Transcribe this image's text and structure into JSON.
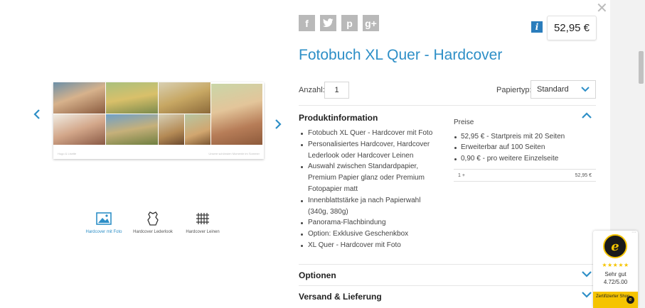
{
  "social": {
    "facebook": "f",
    "twitter": "t",
    "pinterest": "p",
    "googleplus": "g+"
  },
  "price": {
    "info_icon": "i",
    "value": "52,95 €"
  },
  "product": {
    "title": "Fotobuch XL Quer - Hardcover"
  },
  "quantity": {
    "label": "Anzahl:",
    "value": "1"
  },
  "paper_type": {
    "label": "Papiertyp:",
    "selected": "Standard"
  },
  "sections": {
    "produktinformation": "Produktinformation",
    "optionen": "Optionen",
    "versand": "Versand & Lieferung"
  },
  "features": [
    "Fotobuch XL Quer - Hardcover mit Foto",
    "Personalisiertes Hardcover, Hardcover Lederlook oder Hardcover Leinen",
    "Auswahl zwischen Standardpapier, Premium Papier glanz oder Premium Fotopapier matt",
    "Innenblattstärke ja nach Papierwahl (340g, 380g)",
    "Panorama-Flachbindung",
    "Option: Exklusive Geschenkbox",
    "XL Quer - Hardcover mit Foto"
  ],
  "preise": {
    "title": "Preise",
    "items": [
      "52,95 € - Startpreis mit 20 Seiten",
      "Erweiterbar auf 100 Seiten",
      "0,90 € - pro weitere Einzelseite"
    ],
    "tier": {
      "qty": "1 +",
      "price": "52,95 €"
    }
  },
  "book": {
    "footer_left": "Hugo & Lisette",
    "footer_right": "Unsere schönsten Momente im Sommer"
  },
  "variants": [
    {
      "label": "Hardcover mit Foto",
      "icon": "photo-icon"
    },
    {
      "label": "Hardcover Lederlook",
      "icon": "leather-icon"
    },
    {
      "label": "Hardcover Leinen",
      "icon": "linen-icon"
    }
  ],
  "trust": {
    "stars": "★★★★★",
    "rating_text": "Sehr gut",
    "rating_value": "4.72/5.00",
    "badge": "Zertifizierter Shop",
    "seal_letter": "e",
    "dots": "···"
  },
  "colors": {
    "accent": "#2e8fc7",
    "info_blue": "#2b7dbc",
    "trust_yellow": "#f5c400",
    "social_gray": "#b9b9b9"
  }
}
